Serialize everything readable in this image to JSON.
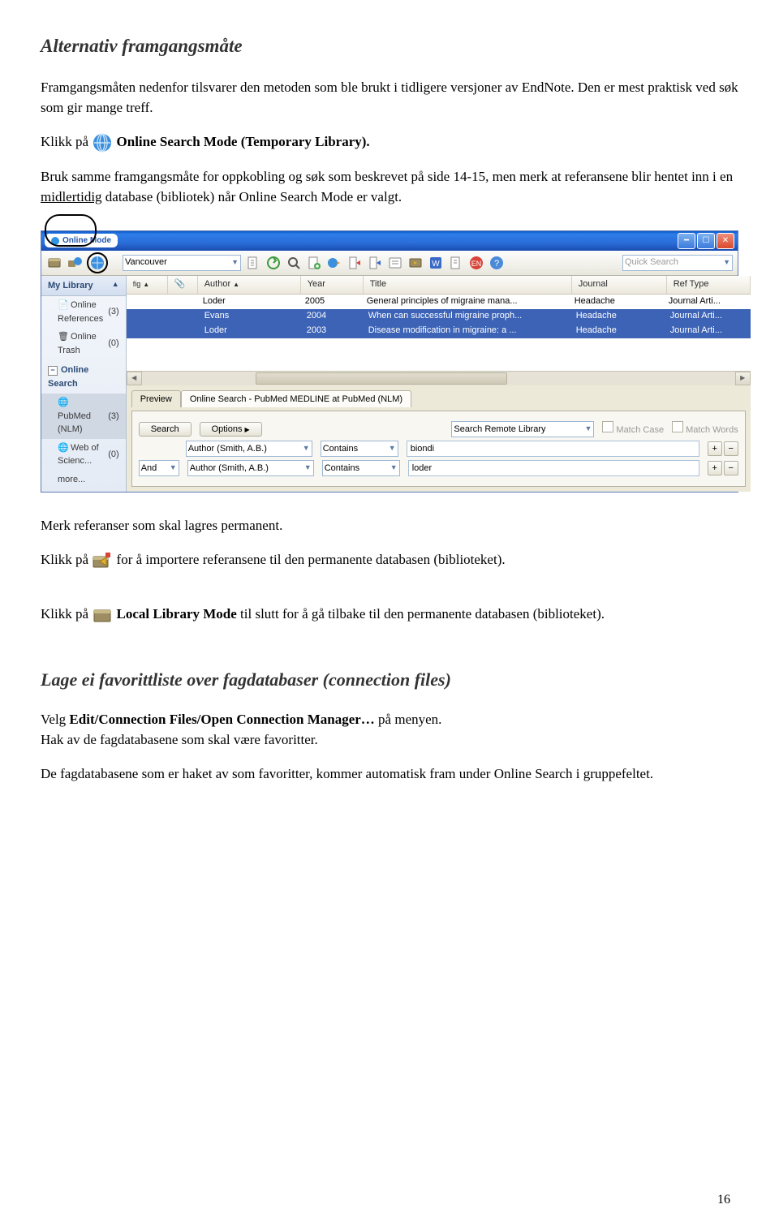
{
  "doc": {
    "heading1": "Alternativ framgangsmåte",
    "para1": "Framgangsmåten nedenfor tilsvarer den metoden som ble brukt i tidligere versjoner av EndNote. Den er mest praktisk ved søk som gir mange treff.",
    "para2_prefix": "Klikk på ",
    "para2_bold": "Online Search Mode (Temporary Library).",
    "para3_a": "Bruk samme framgangsmåte for oppkobling og søk som beskrevet på side 14-15, men merk at referansene blir hentet inn i en ",
    "para3_u": "midlertidig",
    "para3_b": " database (bibliotek) når Online Search Mode er valgt.",
    "para4": "Merk referanser som skal lagres permanent.",
    "para5_prefix": "Klikk på ",
    "para5_suffix": " for å importere referansene til den permanente databasen (biblioteket).",
    "para6_prefix": "Klikk på ",
    "para6_bold": "Local Library Mode",
    "para6_suffix": " til slutt for å gå tilbake til den permanente databasen (biblioteket).",
    "heading2": "Lage ei favorittliste over fagdatabaser (connection files)",
    "para7_a": "Velg ",
    "para7_bold": "Edit/Connection Files/Open Connection Manager…",
    "para7_b": " på menyen.",
    "para8": "Hak av de fagdatabasene som skal være favoritter.",
    "para9": "De fagdatabasene som er haket av som favoritter, kommer automatisk fram under Online Search i gruppefeltet.",
    "pagenum": "16"
  },
  "app": {
    "titlebar_mode": "Online Mode",
    "style_sel": "Vancouver",
    "quicksearch_placeholder": "Quick Search",
    "sidebar": {
      "header": "My Library",
      "items": [
        {
          "label": "Online References",
          "count": "(3)",
          "selected": false
        },
        {
          "label": "Online Trash",
          "count": "(0)",
          "selected": false
        }
      ],
      "group_title": "Online Search",
      "online_items": [
        {
          "label": "PubMed (NLM)",
          "count": "(3)",
          "selected": true
        },
        {
          "label": "Web of Scienc...",
          "count": "(0)",
          "selected": false
        },
        {
          "label": "more...",
          "count": "",
          "selected": false
        }
      ]
    },
    "grid": {
      "headers": [
        "fig",
        "Author",
        "Year",
        "Title",
        "Journal",
        "Ref Type"
      ],
      "rows": [
        {
          "author": "Loder",
          "year": "2005",
          "title": "General principles of migraine mana...",
          "journal": "Headache",
          "reftype": "Journal Arti...",
          "sel": false
        },
        {
          "author": "Evans",
          "year": "2004",
          "title": "When can successful migraine proph...",
          "journal": "Headache",
          "reftype": "Journal Arti...",
          "sel": true
        },
        {
          "author": "Loder",
          "year": "2003",
          "title": "Disease modification in migraine: a ...",
          "journal": "Headache",
          "reftype": "Journal Arti...",
          "sel": true
        }
      ]
    },
    "panel": {
      "tabs": [
        "Preview",
        "Online Search - PubMed MEDLINE at PubMed (NLM)"
      ],
      "btn_search": "Search",
      "btn_options": "Options",
      "remote_label": "Search Remote Library",
      "matchcase": "Match Case",
      "matchwords": "Match Words",
      "rows": [
        {
          "bool": "",
          "field": "Author (Smith, A.B.)",
          "op": "Contains",
          "val": "biondi"
        },
        {
          "bool": "And",
          "field": "Author (Smith, A.B.)",
          "op": "Contains",
          "val": "loder"
        }
      ]
    }
  }
}
